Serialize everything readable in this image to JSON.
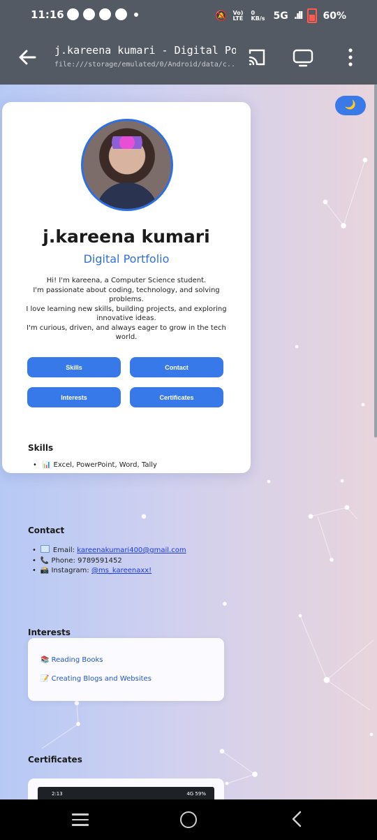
{
  "status_bar": {
    "time": "11:16",
    "network": "5G",
    "battery": "60%",
    "volte": "Vo) LTE",
    "speed": "0 KB/s"
  },
  "browser": {
    "title": "j.kareena kumari - Digital Portfolio",
    "url": "file:///storage/emulated/0/Android/data/c..."
  },
  "portfolio": {
    "theme_toggle": "🌙",
    "name": "j.kareena kumari",
    "subtitle": "Digital Portfolio",
    "bio": [
      "Hi! I'm kareena, a Computer Science student.",
      "I'm passionate about coding, technology, and solving problems.",
      "I love learning new skills, building projects, and exploring innovative ideas.",
      "I'm curious, driven, and always eager to grow in the tech world."
    ],
    "buttons": {
      "skills": "Skills",
      "contact": "Contact",
      "interests": "Interests",
      "certificates": "Certificates"
    },
    "skills": {
      "heading": "Skills",
      "items": [
        "📊 Excel, PowerPoint, Word, Tally"
      ]
    },
    "contact": {
      "heading": "Contact",
      "email_label": "Email:",
      "email": "kareenakumari400@gmail.com",
      "phone_label": "Phone:",
      "phone": "9789591452",
      "instagram_label": "Instagram:",
      "instagram": "@ms_kareenaxx!"
    },
    "interests": {
      "heading": "Interests",
      "items": [
        "📚 Reading Books",
        "📝 Creating Blogs and Websites"
      ]
    },
    "certificates": {
      "heading": "Certificates",
      "preview_time": "2:13",
      "preview_status": "4G 59%"
    }
  },
  "colors": {
    "accent": "#3879ea",
    "toolbar": "#545a63",
    "link": "#1b3ae0"
  }
}
